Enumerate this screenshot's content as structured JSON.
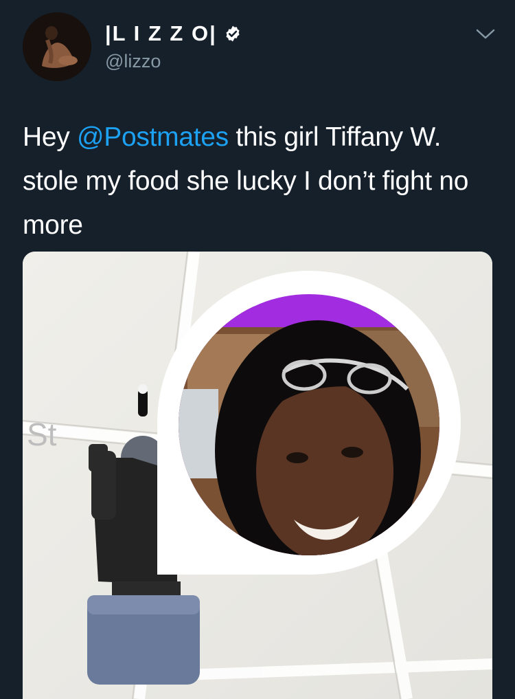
{
  "user": {
    "display_name": "|L I Z Z O|",
    "handle": "@lizzo",
    "verified": true,
    "avatar_icon": "profile-photo"
  },
  "tweet": {
    "text_before": "Hey ",
    "mention": "@Postmates",
    "text_after": " this girl Tiffany W. stole my food she lucky I don’t fight no more"
  },
  "media": {
    "partial_sign_text": "St"
  },
  "colors": {
    "background": "#15202b",
    "primary_text": "#ffffff",
    "secondary_text": "#8899a6",
    "link": "#1da1f2",
    "pin_accent": "#a12ce0"
  },
  "icons": {
    "verified": "verified-badge-icon",
    "menu": "chevron-down-icon"
  }
}
